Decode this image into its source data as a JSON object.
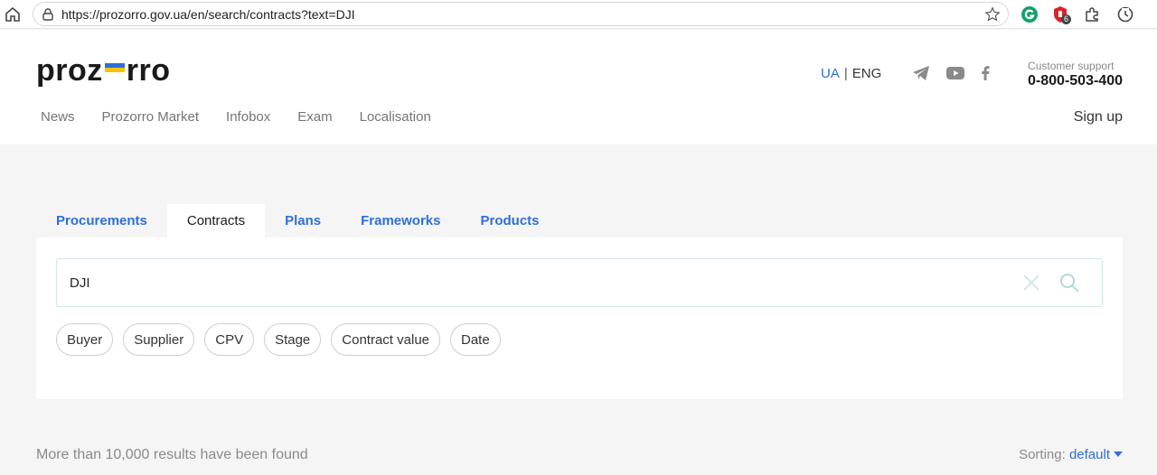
{
  "browser": {
    "url": "https://prozorro.gov.ua/en/search/contracts?text=DJI",
    "extension_badge": "6",
    "icons": [
      "home-icon",
      "site-info-icon",
      "bookmark-star-icon",
      "grammarly-icon",
      "adblock-icon",
      "extensions-icon",
      "history-icon"
    ]
  },
  "header": {
    "logo_left": "proz",
    "logo_right": "rro",
    "lang_ua": "UA",
    "lang_sep": "|",
    "lang_eng": "ENG",
    "social_icons": [
      "telegram-icon",
      "youtube-icon",
      "facebook-icon"
    ],
    "support_label": "Customer support",
    "support_phone": "0-800-503-400",
    "nav": [
      "News",
      "Prozorro Market",
      "Infobox",
      "Exam",
      "Localisation"
    ],
    "signup": "Sign up"
  },
  "tabs": [
    {
      "label": "Procurements",
      "active": false
    },
    {
      "label": "Contracts",
      "active": true
    },
    {
      "label": "Plans",
      "active": false
    },
    {
      "label": "Frameworks",
      "active": false
    },
    {
      "label": "Products",
      "active": false
    }
  ],
  "search": {
    "value": "DJI"
  },
  "filters": [
    "Buyer",
    "Supplier",
    "CPV",
    "Stage",
    "Contract value",
    "Date"
  ],
  "results": {
    "text": "More than 10,000 results have been found",
    "sorting_label": "Sorting:",
    "sorting_value": "default"
  },
  "colors": {
    "accent": "#2f6fd6",
    "flag_blue": "#2f6fd6",
    "flag_yellow": "#f5c400",
    "background": "#f5f5f5"
  }
}
